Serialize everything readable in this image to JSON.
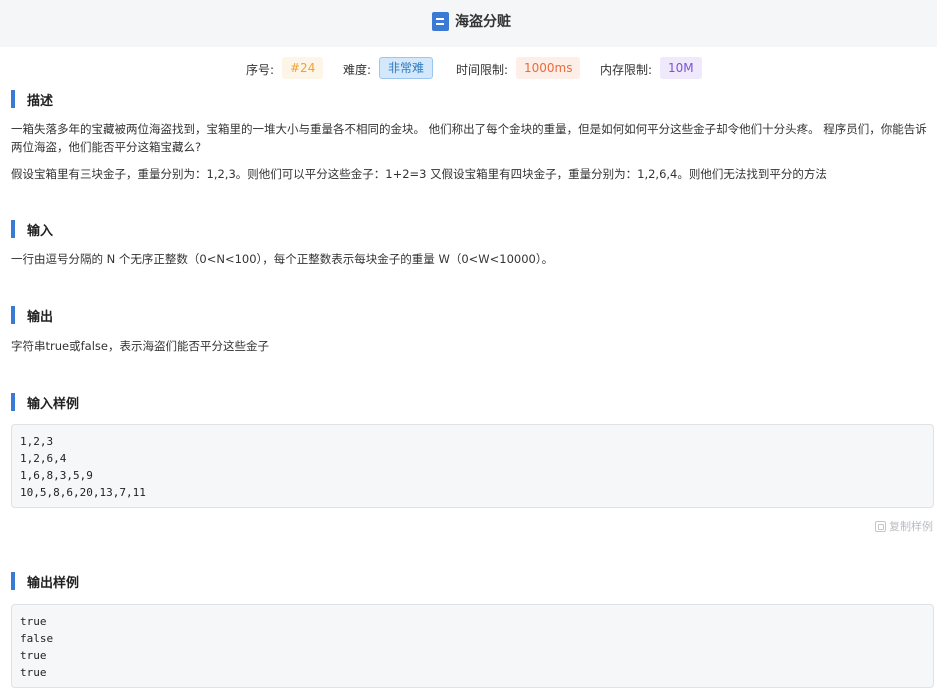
{
  "header": {
    "title": "海盗分赃",
    "icon": "document-icon"
  },
  "meta": {
    "number_label": "序号:",
    "number_value": "#24",
    "difficulty_label": "难度:",
    "difficulty_value": "非常难",
    "time_label": "时间限制:",
    "time_value": "1000ms",
    "memory_label": "内存限制:",
    "memory_value": "10M"
  },
  "sections": {
    "description": {
      "title": "描述",
      "para1": "一箱失落多年的宝藏被两位海盗找到，宝箱里的一堆大小与重量各不相同的金块。 他们称出了每个金块的重量，但是如何如何平分这些金子却令他们十分头疼。 程序员们，你能告诉两位海盗，他们能否平分这箱宝藏么?",
      "para2": "假设宝箱里有三块金子，重量分别为：1,2,3。则他们可以平分这些金子：1+2=3 又假设宝箱里有四块金子，重量分别为：1,2,6,4。则他们无法找到平分的方法"
    },
    "input": {
      "title": "输入",
      "text": "一行由逗号分隔的 N 个无序正整数（0<N<100），每个正整数表示每块金子的重量 W（0<W<10000）。"
    },
    "output": {
      "title": "输出",
      "text": "字符串true或false，表示海盗们能否平分这些金子"
    },
    "sample_input": {
      "title": "输入样例",
      "lines": [
        "1,2,3",
        "1,2,6,4",
        "1,6,8,3,5,9",
        "10,5,8,6,20,13,7,11"
      ],
      "copy_label": "复制样例"
    },
    "sample_output": {
      "title": "输出样例",
      "lines": [
        "true",
        "false",
        "true",
        "true"
      ]
    }
  },
  "colors": {
    "accent": "#3a7ad5",
    "header_bg": "#f5f6f7",
    "code_bg": "#f6f7f9"
  }
}
